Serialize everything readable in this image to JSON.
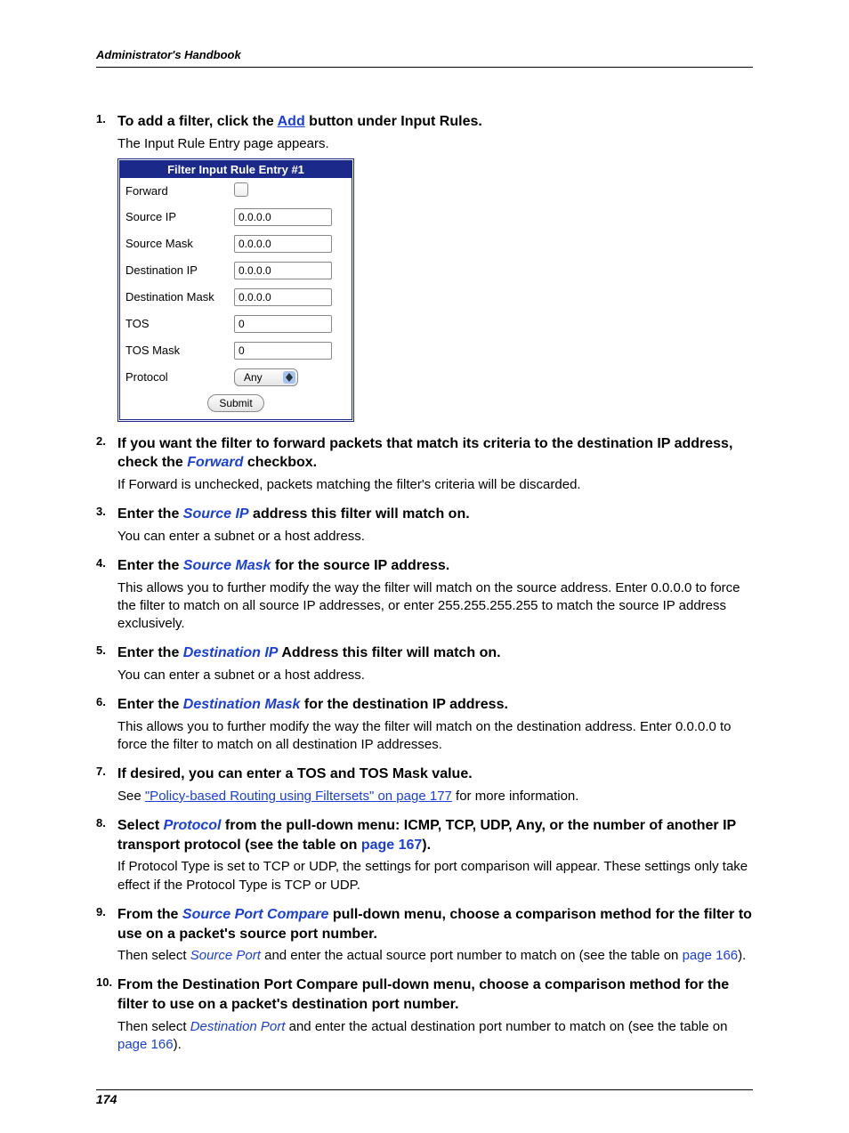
{
  "header": {
    "running_head": "Administrator's Handbook"
  },
  "footer": {
    "page_number": "174"
  },
  "panel": {
    "title": "Filter Input Rule Entry #1",
    "rows": {
      "forward": "Forward",
      "source_ip": "Source IP",
      "source_mask": "Source Mask",
      "dest_ip": "Destination IP",
      "dest_mask": "Destination Mask",
      "tos": "TOS",
      "tos_mask": "TOS Mask",
      "protocol": "Protocol"
    },
    "values": {
      "source_ip": "0.0.0.0",
      "source_mask": "0.0.0.0",
      "dest_ip": "0.0.0.0",
      "dest_mask": "0.0.0.0",
      "tos": "0",
      "tos_mask": "0",
      "protocol": "Any"
    },
    "submit": "Submit"
  },
  "steps": {
    "s1": {
      "pre": "To add a filter, click the ",
      "link": "Add",
      "post": " button under Input Rules.",
      "body": "The Input Rule Entry page appears."
    },
    "s2": {
      "pre": "If you want the filter to forward packets that match its criteria to the destination IP address, check the ",
      "em": "Forward",
      "post": " checkbox.",
      "body": "If Forward is unchecked, packets matching the filter's criteria will be discarded."
    },
    "s3": {
      "pre": "Enter the ",
      "em": "Source IP",
      "post": " address this filter will match on.",
      "body": "You can enter a subnet or a host address."
    },
    "s4": {
      "pre": "Enter the ",
      "em": "Source Mask",
      "post": " for the source IP address.",
      "body": "This allows you to further modify the way the filter will match on the source address. Enter 0.0.0.0 to force the filter to match on all source IP addresses, or enter 255.255.255.255 to match the source IP address exclusively."
    },
    "s5": {
      "pre": "Enter the ",
      "em": "Destination IP",
      "post": " Address this filter will match on.",
      "body": "You can enter a subnet or a host address."
    },
    "s6": {
      "pre": "Enter the ",
      "em": "Destination Mask",
      "post": " for the destination IP address.",
      "body": "This allows you to further modify the way the filter will match on the destination address. Enter 0.0.0.0 to force the filter to match on all destination IP addresses."
    },
    "s7": {
      "title": "If desired, you can enter a TOS and TOS Mask value.",
      "body_pre": "See ",
      "body_link": "\"Policy-based Routing using Filtersets\" on page 177",
      "body_post": " for more information."
    },
    "s8": {
      "pre": "Select ",
      "em": "Protocol",
      "mid": " from the pull-down menu: ICMP, TCP, UDP, Any, or the number of another IP transport protocol (see the table on ",
      "link": "page 167",
      "post": ").",
      "body": "If Protocol Type is set to TCP or UDP, the settings for port comparison will appear. These settings only take effect if the Protocol Type is TCP or UDP."
    },
    "s9": {
      "pre": "From the ",
      "em": "Source Port Compare",
      "post": " pull-down menu, choose a comparison method for the filter to use on a packet's source port number.",
      "body_pre": "Then select ",
      "body_em": "Source Port",
      "body_mid": " and enter the actual source port number to match on (see the table on ",
      "body_link": "page 166",
      "body_post": ")."
    },
    "s10": {
      "title": "From the Destination Port Compare pull-down menu, choose a comparison method for the filter to use on a packet's destination port number.",
      "body_pre": "Then select ",
      "body_em": "Destination Port",
      "body_mid": " and enter the actual destination port number to match on (see the table on ",
      "body_link": "page 166",
      "body_post": ")."
    }
  }
}
